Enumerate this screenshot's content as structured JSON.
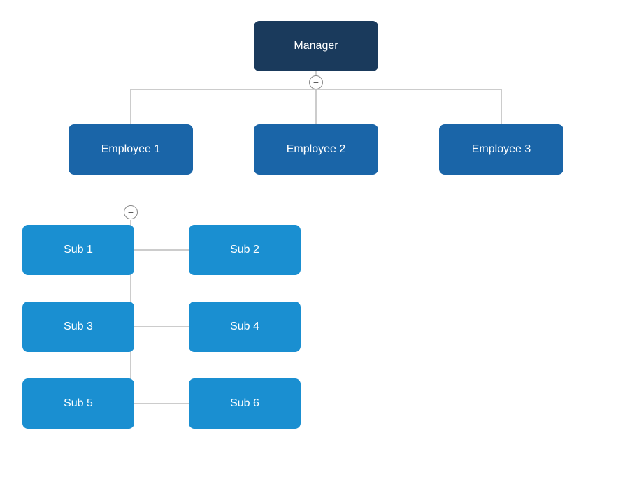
{
  "nodes": {
    "manager": {
      "label": "Manager"
    },
    "employee1": {
      "label": "Employee 1"
    },
    "employee2": {
      "label": "Employee 2"
    },
    "employee3": {
      "label": "Employee 3"
    },
    "sub1": {
      "label": "Sub 1"
    },
    "sub2": {
      "label": "Sub 2"
    },
    "sub3": {
      "label": "Sub 3"
    },
    "sub4": {
      "label": "Sub 4"
    },
    "sub5": {
      "label": "Sub 5"
    },
    "sub6": {
      "label": "Sub 6"
    }
  },
  "toggles": {
    "collapse": "−",
    "expand": "+"
  }
}
